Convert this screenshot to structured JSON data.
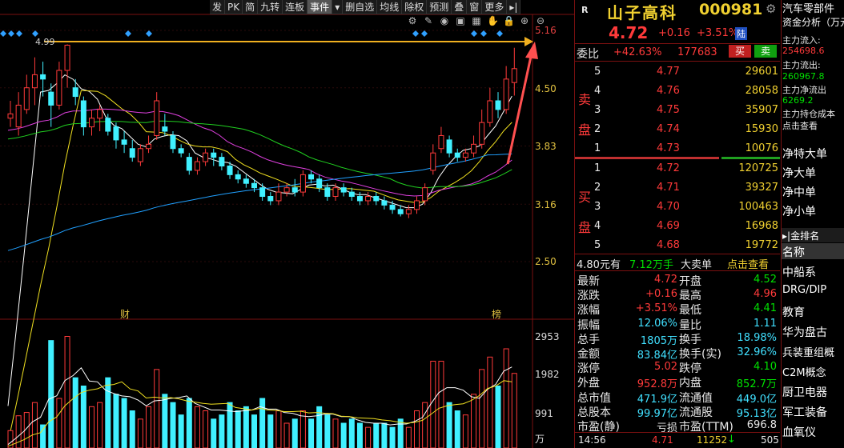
{
  "toolbar": [
    "发",
    "PK",
    "简",
    "九转",
    "连板",
    "事件",
    "▾",
    "删自选",
    "均线",
    "除权",
    "预测",
    "叠",
    "窗",
    "更多",
    "▸|"
  ],
  "toolbar_icons": [
    "gear-icon",
    "pen-icon",
    "eye-icon",
    "image-icon",
    "grid-icon",
    "hand-icon",
    "lock-icon",
    "zoom-in-icon",
    "zoom-out-icon"
  ],
  "chart": {
    "price_labels": [
      "5.16",
      "4.50",
      "3.83",
      "3.16",
      "2.50"
    ],
    "vol_labels": [
      "2953",
      "1982",
      "991",
      "万"
    ],
    "high_marker": "4.99",
    "markers": {
      "cai": "财",
      "bang": "榜"
    },
    "colors": {
      "up": "#ff3a3a",
      "down": "#40f0ff",
      "ma5": "#ffffff",
      "ma10": "#f0e020",
      "ma20": "#e040e0",
      "ma30": "#20d020",
      "ma60": "#20a0ff",
      "arrow": "#ff5050",
      "hline": "#f0b020"
    },
    "candles": [
      [
        4.15,
        4.2,
        4.35,
        4.05,
        420
      ],
      [
        4.05,
        4.3,
        4.45,
        3.95,
        780
      ],
      [
        4.25,
        4.5,
        4.65,
        4.2,
        860
      ],
      [
        4.5,
        4.65,
        4.85,
        4.3,
        1100
      ],
      [
        4.65,
        4.6,
        4.8,
        4.4,
        560
      ],
      [
        4.45,
        4.3,
        4.55,
        4.05,
        2600
      ],
      [
        4.3,
        4.7,
        4.8,
        4.25,
        1200
      ],
      [
        4.7,
        4.99,
        5.0,
        4.5,
        2700
      ],
      [
        4.5,
        4.4,
        4.6,
        4.3,
        1700
      ],
      [
        4.35,
        4.05,
        4.4,
        3.95,
        1500
      ],
      [
        4.05,
        4.15,
        4.25,
        3.95,
        1000
      ],
      [
        4.15,
        4.25,
        4.3,
        4.0,
        1100
      ],
      [
        4.15,
        4.0,
        4.2,
        3.95,
        1700
      ],
      [
        4.05,
        3.9,
        4.1,
        3.8,
        1300
      ],
      [
        3.9,
        3.85,
        4.0,
        3.75,
        1200
      ],
      [
        3.8,
        3.7,
        3.9,
        3.65,
        900
      ],
      [
        3.65,
        3.8,
        3.85,
        3.6,
        700
      ],
      [
        3.8,
        3.85,
        3.95,
        3.75,
        1000
      ],
      [
        3.95,
        4.35,
        4.45,
        3.9,
        1900
      ],
      [
        4.05,
        4.0,
        4.2,
        3.95,
        1300
      ],
      [
        3.95,
        3.8,
        4.0,
        3.75,
        1100
      ],
      [
        3.8,
        3.75,
        3.85,
        3.7,
        800
      ],
      [
        3.7,
        3.55,
        3.75,
        3.5,
        1200
      ],
      [
        3.55,
        3.65,
        3.7,
        3.5,
        1000
      ],
      [
        3.65,
        3.75,
        3.8,
        3.6,
        900
      ],
      [
        3.75,
        3.7,
        3.8,
        3.6,
        700
      ],
      [
        3.7,
        3.6,
        3.75,
        3.55,
        800
      ],
      [
        3.6,
        3.5,
        3.65,
        3.45,
        1100
      ],
      [
        3.5,
        3.45,
        3.55,
        3.4,
        900
      ],
      [
        3.45,
        3.4,
        3.5,
        3.35,
        1000
      ],
      [
        3.4,
        3.35,
        3.45,
        3.3,
        800
      ],
      [
        3.35,
        3.25,
        3.4,
        3.2,
        1200
      ],
      [
        3.25,
        3.2,
        3.3,
        3.15,
        800
      ],
      [
        3.2,
        3.3,
        3.4,
        3.15,
        900
      ],
      [
        3.3,
        3.35,
        3.4,
        3.25,
        600
      ],
      [
        3.35,
        3.3,
        3.45,
        3.25,
        700
      ],
      [
        3.3,
        3.5,
        3.55,
        3.25,
        900
      ],
      [
        3.5,
        3.45,
        3.55,
        3.4,
        700
      ],
      [
        3.45,
        3.35,
        3.5,
        3.3,
        1000
      ],
      [
        3.35,
        3.25,
        3.4,
        3.2,
        800
      ],
      [
        3.25,
        3.35,
        3.4,
        3.2,
        700
      ],
      [
        3.35,
        3.3,
        3.4,
        3.25,
        600
      ],
      [
        3.3,
        3.25,
        3.35,
        3.2,
        700
      ],
      [
        3.25,
        3.2,
        3.3,
        3.15,
        600
      ],
      [
        3.2,
        3.25,
        3.3,
        3.15,
        500
      ],
      [
        3.25,
        3.2,
        3.3,
        3.15,
        600
      ],
      [
        3.2,
        3.15,
        3.25,
        3.1,
        600
      ],
      [
        3.15,
        3.1,
        3.2,
        3.05,
        500
      ],
      [
        3.1,
        3.05,
        3.15,
        3.02,
        700
      ],
      [
        3.05,
        3.1,
        3.15,
        3.0,
        500
      ],
      [
        3.1,
        3.2,
        3.25,
        3.05,
        900
      ],
      [
        3.2,
        3.35,
        3.4,
        3.15,
        1100
      ],
      [
        3.55,
        3.75,
        3.85,
        3.5,
        2100
      ],
      [
        3.8,
        3.95,
        4.05,
        3.75,
        2100
      ],
      [
        3.9,
        3.75,
        3.95,
        3.7,
        1100
      ],
      [
        3.75,
        3.7,
        3.8,
        3.65,
        900
      ],
      [
        3.7,
        3.75,
        3.8,
        3.65,
        800
      ],
      [
        3.75,
        3.85,
        3.95,
        3.7,
        1300
      ],
      [
        3.85,
        4.1,
        4.25,
        3.8,
        1900
      ],
      [
        4.1,
        4.35,
        4.5,
        4.05,
        2200
      ],
      [
        4.35,
        4.25,
        4.45,
        4.15,
        1500
      ],
      [
        4.25,
        4.6,
        4.75,
        4.2,
        2400
      ],
      [
        4.56,
        4.72,
        4.96,
        4.41,
        1805
      ]
    ]
  },
  "stock": {
    "name": "山子高科",
    "code": "000981",
    "price": "4.72",
    "change": "+0.16",
    "pct": "+3.51%",
    "board": "陆",
    "r_icon": "R"
  },
  "weibi": {
    "label": "委比",
    "pct": "+42.63%",
    "diff": "177683",
    "buy": "买",
    "sell": "卖"
  },
  "sell_side": "卖盘",
  "buy_side": "买盘",
  "asks": [
    {
      "n": "5",
      "p": "4.77",
      "v": "29601"
    },
    {
      "n": "4",
      "p": "4.76",
      "v": "28058"
    },
    {
      "n": "3",
      "p": "4.75",
      "v": "35907"
    },
    {
      "n": "2",
      "p": "4.74",
      "v": "15930"
    },
    {
      "n": "1",
      "p": "4.73",
      "v": "10076"
    }
  ],
  "bids": [
    {
      "n": "1",
      "p": "4.72",
      "v": "120725"
    },
    {
      "n": "2",
      "p": "4.71",
      "v": "39327"
    },
    {
      "n": "3",
      "p": "4.70",
      "v": "100463"
    },
    {
      "n": "4",
      "p": "4.69",
      "v": "16968"
    },
    {
      "n": "5",
      "p": "4.68",
      "v": "19772"
    }
  ],
  "big_order": {
    "price": "4.80元有",
    "amount": "7.12万手",
    "label": "大卖单",
    "action": "点击查看"
  },
  "stats": [
    [
      "最新",
      "4.72",
      "开盘",
      "4.52"
    ],
    [
      "涨跌",
      "+0.16",
      "最高",
      "4.96"
    ],
    [
      "涨幅",
      "+3.51%",
      "最低",
      "4.41"
    ],
    [
      "振幅",
      "12.06%",
      "量比",
      "1.11"
    ],
    [
      "总手",
      "1805万",
      "换手",
      "18.98%"
    ],
    [
      "金额",
      "83.84亿",
      "换手(实)",
      "32.96%"
    ],
    [
      "涨停",
      "5.02",
      "跌停",
      "4.10"
    ],
    [
      "外盘",
      "952.8万",
      "内盘",
      "852.7万"
    ],
    [
      "总市值",
      "471.9亿",
      "流通值",
      "449.0亿"
    ],
    [
      "总股本",
      "99.97亿",
      "流通股",
      "95.13亿"
    ],
    [
      "市盈(静)",
      "亏损",
      "市盈(TTM)",
      "696.8"
    ]
  ],
  "tick": {
    "time": "14:56",
    "price": "4.71",
    "vol": "11252",
    "dir": "↓",
    "num": "505"
  },
  "side": {
    "top": "汽车零部件",
    "fund_title": "资金分析（万元）",
    "inflow_label": "主力流入:",
    "inflow": "254698.6",
    "outflow_label": "主力流出:",
    "outflow": "260967.8",
    "net_label": "主力净流出",
    "net": "6269.2",
    "cost_label": "主力持仓成本",
    "cost_action": "点击查看",
    "nets": [
      "净特大单",
      "净大单",
      "净中单",
      "净小单"
    ],
    "rank_title": "▸|金排名",
    "items": [
      "名称",
      "中船系",
      "DRG/DIP",
      "教育",
      "华为盘古",
      "兵装重组概",
      "C2M概念",
      "厨卫电器",
      "军工装备",
      "血氧仪"
    ]
  }
}
